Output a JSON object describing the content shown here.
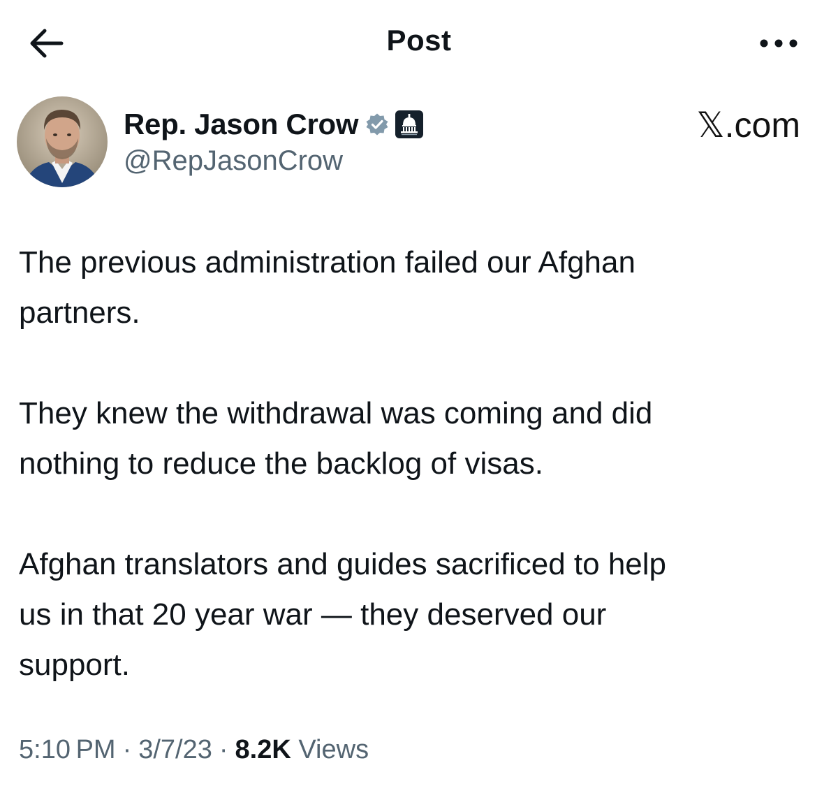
{
  "header": {
    "title": "Post",
    "back_icon": "arrow-left-icon",
    "more_icon": "more-horizontal-icon"
  },
  "author": {
    "name": "Rep. Jason Crow",
    "handle": "@RepJasonCrow",
    "verified_icon": "verified-badge-icon",
    "verified_color": "#829aab",
    "affiliation_icon": "capitol-dome-icon",
    "affiliation_color": "#15202b"
  },
  "watermark": "𝕏.com",
  "post": {
    "paragraphs": [
      "The previous administration failed our Afghan\npartners.",
      "They knew the withdrawal was coming and did\nnothing to reduce the backlog of visas.",
      "Afghan translators and guides sacrificed to help\nus in that 20 year war — they deserved our\nsupport."
    ]
  },
  "meta": {
    "time": "5:10 PM",
    "date": "3/7/23",
    "separator": "·",
    "views_count": "8.2K",
    "views_label": "Views"
  },
  "colors": {
    "text_primary": "#0f1419",
    "text_secondary": "#536471",
    "background": "#ffffff"
  }
}
